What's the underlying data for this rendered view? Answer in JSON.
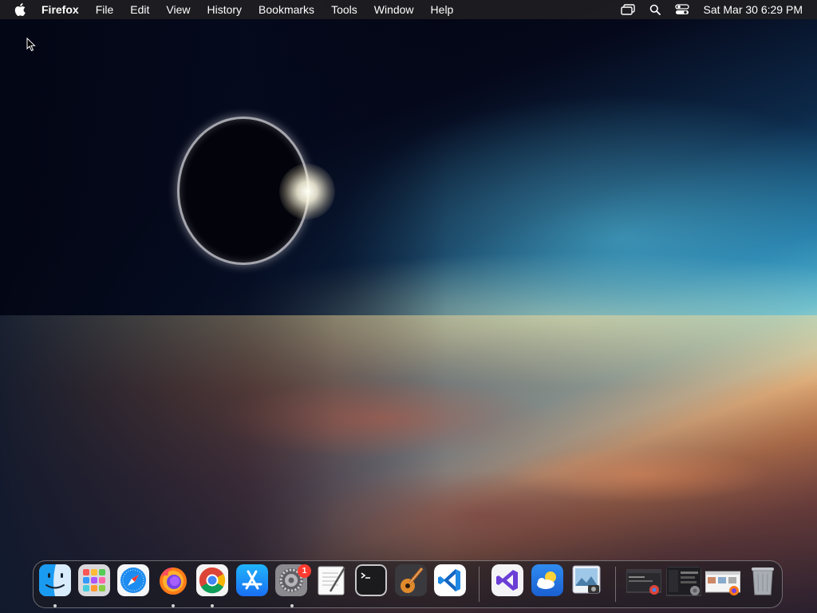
{
  "menubar": {
    "apple_icon": "apple-logo-icon",
    "app_name": "Firefox",
    "items": [
      "File",
      "Edit",
      "View",
      "History",
      "Bookmarks",
      "Tools",
      "Window",
      "Help"
    ],
    "status_icons": [
      "screen-mirroring-icon",
      "spotlight-search-icon",
      "control-center-icon"
    ],
    "clock": "Sat Mar 30  6:29 PM"
  },
  "dock": {
    "apps": [
      {
        "name": "Finder",
        "icon": "finder-icon",
        "running": true
      },
      {
        "name": "Launchpad",
        "icon": "launchpad-icon",
        "running": false
      },
      {
        "name": "Safari",
        "icon": "safari-icon",
        "running": false
      },
      {
        "name": "Firefox",
        "icon": "firefox-icon",
        "running": true
      },
      {
        "name": "Google Chrome",
        "icon": "chrome-icon",
        "running": true
      },
      {
        "name": "App Store",
        "icon": "app-store-icon",
        "running": false
      },
      {
        "name": "System Settings",
        "icon": "system-settings-icon",
        "running": true,
        "badge": "1"
      },
      {
        "name": "TextEdit",
        "icon": "textedit-icon",
        "running": false
      },
      {
        "name": "Terminal",
        "icon": "terminal-icon",
        "running": false
      },
      {
        "name": "GarageBand",
        "icon": "garageband-icon",
        "running": false
      },
      {
        "name": "Visual Studio Code",
        "icon": "vscode-icon",
        "running": false
      },
      {
        "name": "Visual Studio",
        "icon": "visual-studio-icon",
        "running": false
      },
      {
        "name": "Weather",
        "icon": "weather-icon",
        "running": false
      },
      {
        "name": "Preview",
        "icon": "preview-icon",
        "running": false
      }
    ],
    "minimized_windows": [
      "chrome-window-thumbnail",
      "settings-window-thumbnail",
      "firefox-window-thumbnail"
    ],
    "trash_icon": "trash-icon"
  },
  "colors": {
    "menubar_bg": "#1e1e22",
    "badge": "#ff3b30",
    "vscode_blue": "#1e88e5",
    "appstore_blue": "#1c8ef9"
  }
}
